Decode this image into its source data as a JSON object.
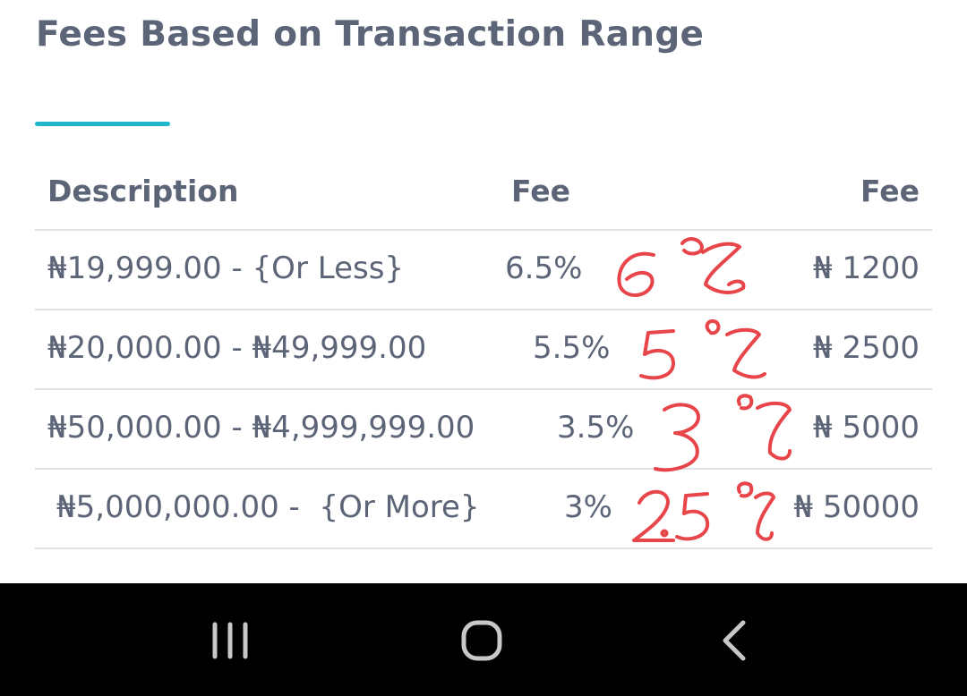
{
  "page": {
    "title": "Fees Based on Transaction Range",
    "accent_color": "#1eb7cc",
    "text_color": "#5c6577",
    "divider_color": "#dfe1e4"
  },
  "table": {
    "headers": {
      "description": "Description",
      "percent_fee": "Fee",
      "flat_fee": "Fee"
    },
    "rows": [
      {
        "description": "₦19,999.00 - {Or Less}",
        "percent_fee": "6.5%",
        "flat_fee": "₦ 1200"
      },
      {
        "description": "₦20,000.00 - ₦49,999.00",
        "percent_fee": "5.5%",
        "flat_fee": "₦ 2500"
      },
      {
        "description": "₦50,000.00 - ₦4,999,999.00",
        "percent_fee": "3.5%",
        "flat_fee": "₦ 5000"
      },
      {
        "description": "₦5,000,000.00 -  {Or More}",
        "percent_fee": "3%",
        "flat_fee": "₦ 50000"
      }
    ]
  },
  "handwritten_annotations": {
    "ink_color": "#e8454a",
    "items": [
      "6%",
      "5%",
      "3%",
      "2.5%"
    ]
  },
  "navigation_bar": {
    "background": "#000000",
    "icon_color": "#c8c8c8",
    "buttons": [
      "recents-icon",
      "home-icon",
      "back-icon"
    ]
  }
}
